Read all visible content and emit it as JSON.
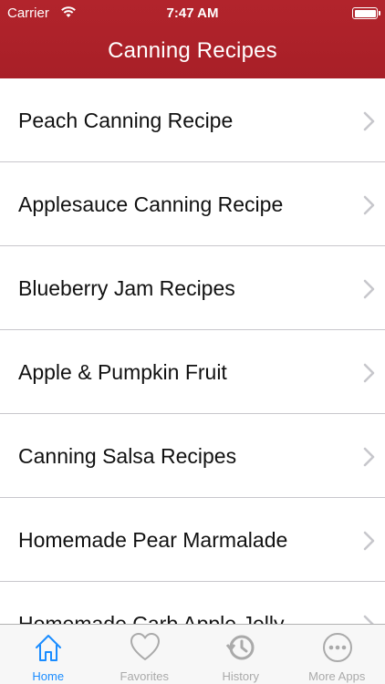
{
  "status_bar": {
    "carrier": "Carrier",
    "time": "7:47 AM"
  },
  "nav": {
    "title": "Canning Recipes"
  },
  "recipes": [
    {
      "label": "Peach Canning Recipe"
    },
    {
      "label": "Applesauce Canning Recipe"
    },
    {
      "label": "Blueberry Jam Recipes"
    },
    {
      "label": "Apple & Pumpkin Fruit"
    },
    {
      "label": "Canning Salsa Recipes"
    },
    {
      "label": "Homemade Pear Marmalade"
    },
    {
      "label": "Homemade Carb Apple Jelly"
    }
  ],
  "tabbar": {
    "tabs": [
      {
        "label": "Home",
        "icon": "home-icon",
        "active": true
      },
      {
        "label": "Favorites",
        "icon": "heart-icon",
        "active": false
      },
      {
        "label": "History",
        "icon": "history-icon",
        "active": false
      },
      {
        "label": "More Apps",
        "icon": "more-icon",
        "active": false
      }
    ]
  },
  "colors": {
    "header": "#b2242c",
    "tab_active": "#1a8cff",
    "tab_inactive": "#aaaaaa"
  }
}
